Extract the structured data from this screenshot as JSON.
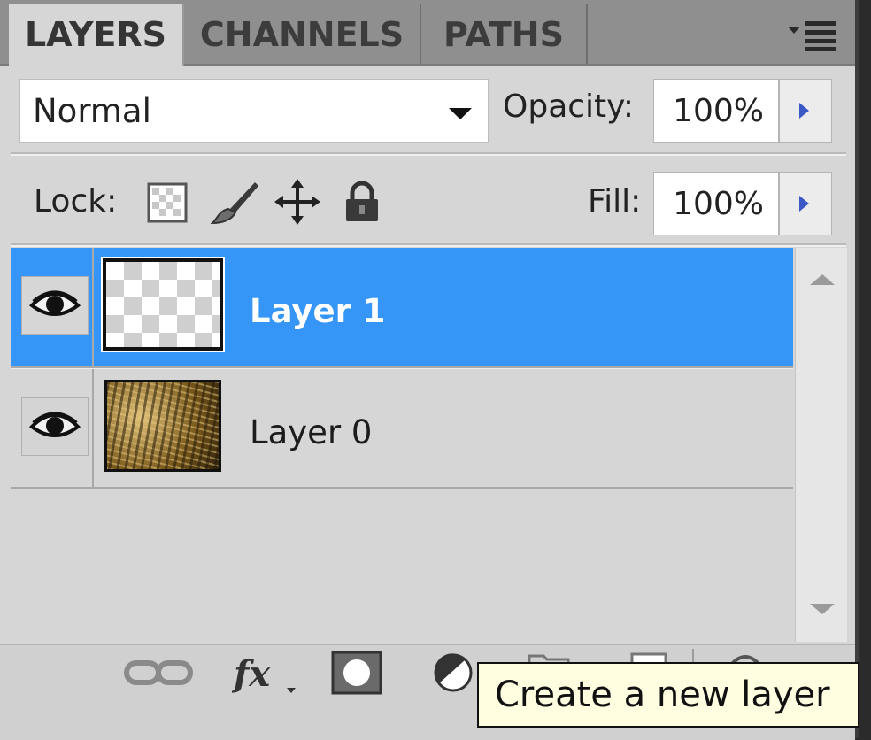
{
  "tabs": [
    {
      "label": "LAYERS",
      "active": true
    },
    {
      "label": "CHANNELS",
      "active": false
    },
    {
      "label": "PATHS",
      "active": false
    }
  ],
  "panel_menu_icon": "panel-menu-icon",
  "blend_mode": {
    "value": "Normal"
  },
  "opacity": {
    "label": "Opacity:",
    "value": "100%"
  },
  "lock": {
    "label": "Lock:",
    "icons": [
      "lock-transparent-pixels-icon",
      "lock-image-pixels-icon",
      "lock-position-icon",
      "lock-all-icon"
    ]
  },
  "fill": {
    "label": "Fill:",
    "value": "100%"
  },
  "layers": [
    {
      "name": "Layer 1",
      "selected": true,
      "visible": true,
      "thumbnail": "transparent"
    },
    {
      "name": "Layer 0",
      "selected": false,
      "visible": true,
      "thumbnail": "photo"
    }
  ],
  "bottom_icons": [
    "link-layers-icon",
    "layer-style-fx-icon",
    "add-mask-icon",
    "adjustment-layer-icon",
    "new-group-folder-icon",
    "new-layer-icon",
    "delete-layer-icon"
  ],
  "tooltip": "Create a new layer",
  "colors": {
    "selection": "#3596f7",
    "panel": "#d6d6d6",
    "tab_inactive": "#8f8f8f",
    "tooltip_bg": "#fffee1"
  }
}
